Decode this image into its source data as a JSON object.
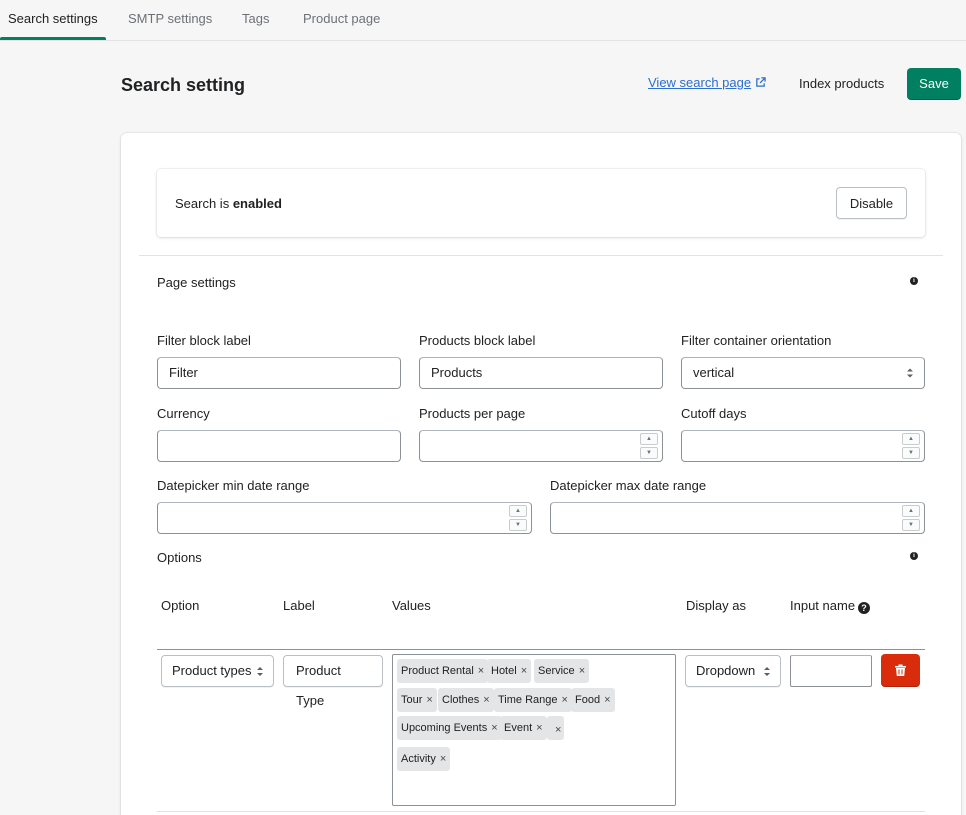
{
  "tabs": [
    {
      "label": "Search settings",
      "active": true
    },
    {
      "label": "SMTP settings",
      "active": false
    },
    {
      "label": "Tags",
      "active": false
    },
    {
      "label": "Product page",
      "active": false
    }
  ],
  "header": {
    "title": "Search setting",
    "view_link": "View search page",
    "index_label": "Index products",
    "save_label": "Save"
  },
  "status": {
    "prefix": "Search is ",
    "state": "enabled",
    "disable_label": "Disable"
  },
  "page_settings": {
    "title": "Page settings",
    "filter_block_label": {
      "label": "Filter block label",
      "value": "Filter"
    },
    "products_block_label": {
      "label": "Products block label",
      "value": "Products"
    },
    "filter_orientation": {
      "label": "Filter container orientation",
      "value": "vertical"
    },
    "currency": {
      "label": "Currency",
      "value": ""
    },
    "products_per_page": {
      "label": "Products per page",
      "value": ""
    },
    "cutoff_days": {
      "label": "Cutoff days",
      "value": ""
    },
    "datepicker_min": {
      "label": "Datepicker min date range",
      "value": ""
    },
    "datepicker_max": {
      "label": "Datepicker max date range",
      "value": ""
    }
  },
  "options": {
    "title": "Options",
    "columns": {
      "option": "Option",
      "label": "Label",
      "values": "Values",
      "display_as": "Display as",
      "input_name": "Input name"
    },
    "row": {
      "option": "Product types",
      "label": "Product Type",
      "values": [
        "Product Rental",
        "Hotel",
        "Service",
        "Tour",
        "Clothes",
        "Time Range",
        "Food",
        "Upcoming Events",
        "Event",
        "",
        "Activity"
      ],
      "display_as": "Dropdown",
      "input_name": ""
    }
  },
  "colors": {
    "primary": "#008060",
    "danger": "#d82c0d",
    "link": "#2c6ecb"
  }
}
